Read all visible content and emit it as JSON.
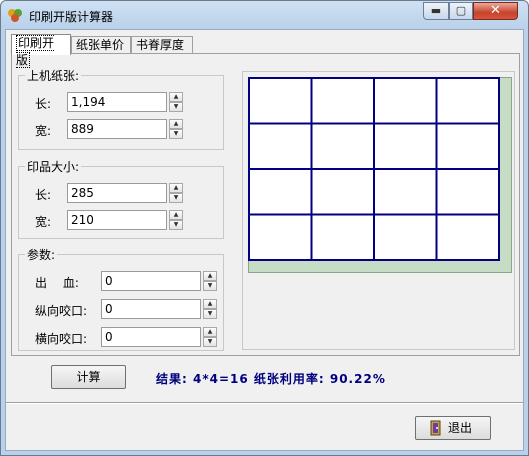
{
  "window": {
    "title": "印刷开版计算器",
    "min_glyph": "▬",
    "max_glyph": "▢",
    "close_glyph": "✕"
  },
  "tabs": [
    {
      "label": "印刷开版",
      "active": true
    },
    {
      "label": "纸张单价",
      "active": false
    },
    {
      "label": "书脊厚度",
      "active": false
    }
  ],
  "press_paper": {
    "legend": "上机纸张:",
    "length_label": "长:",
    "length_value": "1,194",
    "width_label": "宽:",
    "width_value": "889"
  },
  "print_size": {
    "legend": "印品大小:",
    "length_label": "长:",
    "length_value": "285",
    "width_label": "宽:",
    "width_value": "210"
  },
  "params": {
    "legend": "参数:",
    "bleed_label": "出　 血:",
    "bleed_value": "0",
    "vertical_grip_label": "纵向咬口:",
    "vertical_grip_value": "0",
    "horizontal_grip_label": "横向咬口:",
    "horizontal_grip_value": "0"
  },
  "layout_preview": {
    "rows": 4,
    "cols": 4,
    "grid_color": "#000080",
    "paper_color": "#c7dcc5"
  },
  "actions": {
    "calculate_label": "计算",
    "exit_label": "退出"
  },
  "result_text": "结果: 4*4=16  纸张利用率: 90.22%",
  "colors": {
    "result": "#00007f",
    "close_button": "#c7432b"
  }
}
